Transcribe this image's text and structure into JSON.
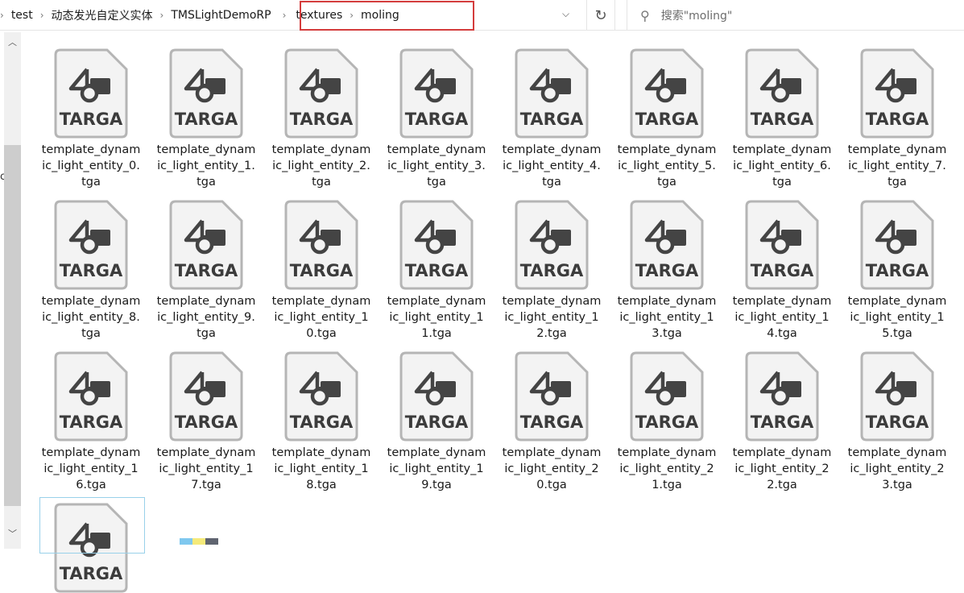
{
  "breadcrumb": [
    "test",
    "动态发光自定义实体",
    "TMSLightDemoRP",
    "textures",
    "moling"
  ],
  "search": {
    "placeholder": "搜索\"moling\""
  },
  "icons": {
    "refresh": "refresh-icon",
    "search": "search-icon",
    "dropdown": "chevron-down-icon"
  },
  "left_edge_text": "c",
  "icon_text": "TARGA",
  "files": [
    "template_dynamic_light_entity_0.tga",
    "template_dynamic_light_entity_1.tga",
    "template_dynamic_light_entity_2.tga",
    "template_dynamic_light_entity_3.tga",
    "template_dynamic_light_entity_4.tga",
    "template_dynamic_light_entity_5.tga",
    "template_dynamic_light_entity_6.tga",
    "template_dynamic_light_entity_7.tga",
    "template_dynamic_light_entity_8.tga",
    "template_dynamic_light_entity_9.tga",
    "template_dynamic_light_entity_10.tga",
    "template_dynamic_light_entity_11.tga",
    "template_dynamic_light_entity_12.tga",
    "template_dynamic_light_entity_13.tga",
    "template_dynamic_light_entity_14.tga",
    "template_dynamic_light_entity_15.tga",
    "template_dynamic_light_entity_16.tga",
    "template_dynamic_light_entity_17.tga",
    "template_dynamic_light_entity_18.tga",
    "template_dynamic_light_entity_19.tga",
    "template_dynamic_light_entity_20.tga",
    "template_dynamic_light_entity_21.tga",
    "template_dynamic_light_entity_22.tga",
    "template_dynamic_light_entity_23.tga"
  ],
  "colors": {
    "highlight": "#d43c3c",
    "selection": "#99d1ea"
  }
}
